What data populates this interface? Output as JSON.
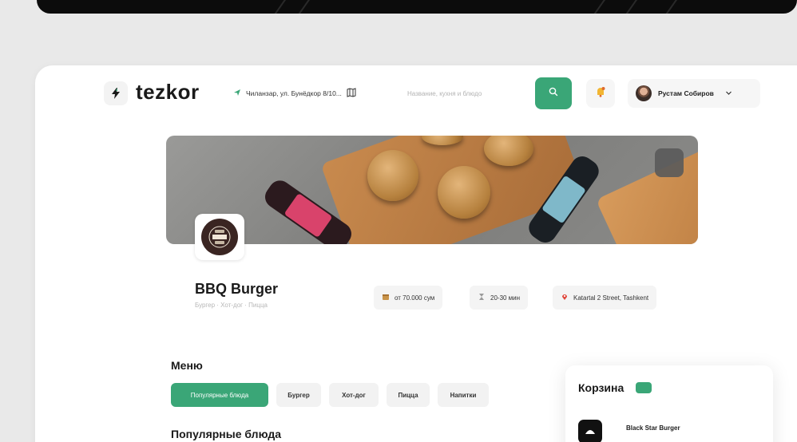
{
  "header": {
    "logo_text": "tezkor",
    "location": "Чиланзар, ул. Бунёдкор 8/10...",
    "search_placeholder": "Название, кухня и блюдо",
    "user_name": "Рустам Собиров"
  },
  "restaurant": {
    "name": "BBQ Burger",
    "tags": "Бургер · Хот-дог · Пицца",
    "min_order": "от 70.000 сум",
    "delivery_time": "20-30 мин",
    "address": "Katartal 2 Street, Tashkent"
  },
  "menu": {
    "title": "Меню",
    "tabs": [
      "Популярные блюда",
      "Бургер",
      "Хот-дог",
      "Пицца",
      "Напитки"
    ],
    "active_tab": 0,
    "section_title": "Популярные блюда"
  },
  "cart": {
    "title": "Корзина",
    "count": "",
    "items": [
      {
        "name": "Black Star Burger"
      }
    ]
  },
  "colors": {
    "accent": "#3aa677",
    "page_bg": "#e9e9e9",
    "card_bg": "#ffffff"
  },
  "icons": {
    "logo": "lightning-icon",
    "location": "send-arrow-icon",
    "map": "map-icon",
    "search": "search-icon",
    "notification": "bell-icon",
    "chevron": "chevron-down-icon",
    "min_order": "box-icon",
    "delivery_time": "hourglass-icon",
    "address": "pin-icon"
  }
}
